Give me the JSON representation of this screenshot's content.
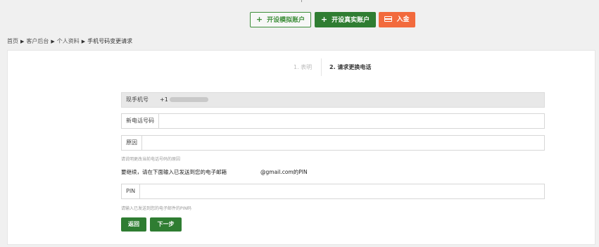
{
  "topbar": {
    "demo_account_label": "开设模拟账户",
    "real_account_label": "开设真实账户",
    "deposit_label": "入金"
  },
  "breadcrumb": {
    "items": [
      "首页",
      "客户后台",
      "个人资料",
      "手机号码变更请求"
    ]
  },
  "steps": {
    "step1": "1. 表明",
    "step2": "2. 请求更换电话"
  },
  "form": {
    "current_phone_label": "现手机号",
    "current_phone_value": "+1",
    "new_phone_label": "新电话号码",
    "new_phone_value": "",
    "reason_label": "原因",
    "reason_value": "",
    "reason_hint": "请说明更改当前电话号码的原因",
    "pin_message": "要继续，请在下面输入已发送到您的电子邮箱",
    "pin_message_email": "@gmail.com的PIN",
    "pin_label": "PIN",
    "pin_value": "",
    "pin_hint": "请输入已发送到您的电子邮件的PIN码"
  },
  "actions": {
    "back_label": "返回",
    "next_label": "下一步"
  },
  "colors": {
    "primary_green": "#2f7d32",
    "deposit_orange": "#f26a3d"
  }
}
